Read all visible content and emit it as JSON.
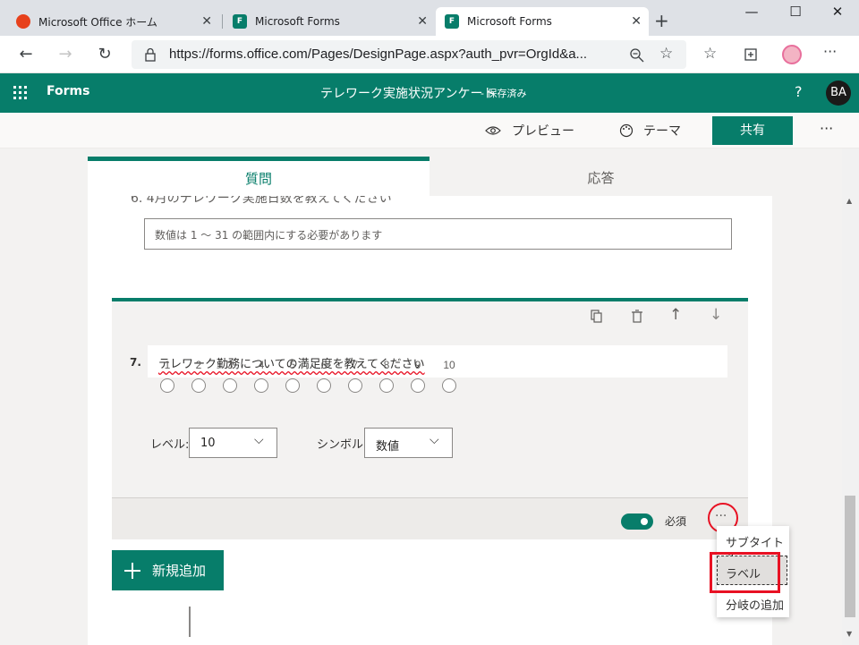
{
  "browser": {
    "tabs": [
      {
        "title": "Microsoft Office ホーム",
        "icon": "office-icon"
      },
      {
        "title": "Microsoft Forms",
        "icon": "forms-icon"
      },
      {
        "title": "Microsoft Forms",
        "icon": "forms-icon"
      }
    ],
    "new_tab": "+",
    "url": "https://forms.office.com/Pages/DesignPage.aspx?auth_pvr=OrgId&a...",
    "window_controls": [
      "—",
      "☐",
      "✕"
    ]
  },
  "app": {
    "name": "Forms",
    "form_title": "テレワーク実施状況アンケート",
    "save_status": "- 保存済み",
    "help": "?",
    "avatar": "BA"
  },
  "commands": {
    "preview": "プレビュー",
    "theme": "テーマ",
    "share": "共有",
    "more": "···"
  },
  "question_tabs": {
    "questions": "質問",
    "responses": "応答"
  },
  "prev_question": {
    "partial_title": "6. 4月のテレワーク実施日数を教えてください",
    "placeholder": "数値は 1 ～ 31 の範囲内にする必要があります"
  },
  "question": {
    "number": "7.",
    "title": "テレワーク勤務についての満足度を教えてください",
    "scale": [
      "1",
      "2",
      "3",
      "4",
      "5",
      "6",
      "7",
      "8",
      "9",
      "10"
    ],
    "level_label": "レベル:",
    "level_value": "10",
    "symbol_label": "シンボル:",
    "symbol_value": "数値",
    "required_label": "必須",
    "required_on": true,
    "more": "···"
  },
  "add_new": "新規追加",
  "context_menu": [
    "サブタイトル",
    "ラベル",
    "分岐の追加"
  ],
  "colors": {
    "accent": "#077d6a",
    "highlight": "#e81123"
  }
}
